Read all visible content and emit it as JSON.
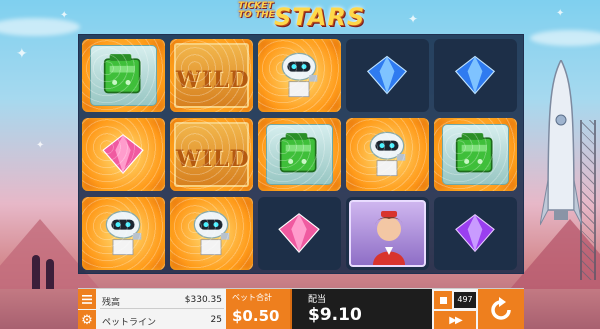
{
  "title": {
    "top": "TICKET TO THE",
    "main": "STARS"
  },
  "reels": [
    [
      {
        "symbol": "green-battery",
        "win": true
      },
      {
        "symbol": "pink-gem",
        "win": true
      },
      {
        "symbol": "robot",
        "win": true
      }
    ],
    [
      {
        "symbol": "wild",
        "win": true,
        "text": "WILD"
      },
      {
        "symbol": "wild",
        "win": true,
        "text": "WILD"
      },
      {
        "symbol": "robot",
        "win": true
      }
    ],
    [
      {
        "symbol": "robot",
        "win": true
      },
      {
        "symbol": "green-battery",
        "win": true
      },
      {
        "symbol": "pink-gem",
        "win": false
      }
    ],
    [
      {
        "symbol": "blue-gem",
        "win": false
      },
      {
        "symbol": "robot",
        "win": true
      },
      {
        "symbol": "stewardess",
        "win": false
      }
    ],
    [
      {
        "symbol": "blue-gem",
        "win": false
      },
      {
        "symbol": "green-battery",
        "win": true
      },
      {
        "symbol": "purple-gem",
        "win": false
      }
    ]
  ],
  "controls": {
    "balance_label": "残高",
    "balance_value": "$330.35",
    "lines_label": "ペットライン",
    "lines_value": "25",
    "total_bet_label": "ベット合計",
    "total_bet_value": "$0.50",
    "win_label": "配当",
    "win_value": "$9.10",
    "autoplay_count": "497",
    "menu_icon": "hamburger-icon",
    "settings_icon": "gear-icon",
    "stop_icon": "stop-icon",
    "turbo_icon": "fast-forward-icon",
    "spin_icon": "spin-icon"
  },
  "colors": {
    "accent": "#ee7f1e",
    "reel_bg": "#1d2f48",
    "win_glow": "#ffb020"
  }
}
